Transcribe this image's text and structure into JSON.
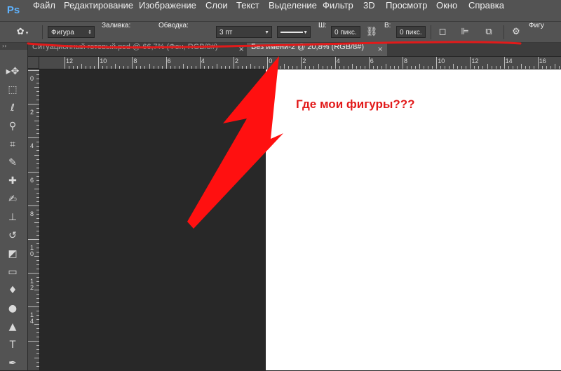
{
  "app": {
    "logo": "Ps"
  },
  "menu": {
    "items": [
      "Файл",
      "Редактирование",
      "Изображение",
      "Слои",
      "Текст",
      "Выделение",
      "Фильтр",
      "3D",
      "Просмотр",
      "Окно",
      "Справка"
    ]
  },
  "options": {
    "mode_value": "Фигура",
    "fill_label": "Заливка:",
    "fill_color": "#857c0b",
    "stroke_label": "Обводка:",
    "stroke_width_value": "3 пт",
    "width_label": "Ш:",
    "width_value": "0 пикс.",
    "height_label": "В:",
    "height_value": "0 пикс.",
    "shape_label": "Фигу"
  },
  "tabs": [
    {
      "label": "Ситуационный готовый.psd @ 66,7% (Фон, RGB/8#)",
      "close": "×",
      "active": false
    },
    {
      "label": "Без имени-2 @ 20,8% (RGB/8#)",
      "close": "×",
      "active": true
    }
  ],
  "rulers": {
    "horizontal": [
      "12",
      "10",
      "8",
      "6",
      "4",
      "2",
      "0",
      "2",
      "4",
      "6",
      "8",
      "10",
      "12",
      "14",
      "16"
    ],
    "vertical": [
      "0",
      "2",
      "4",
      "6",
      "8",
      "1 0",
      "1 2",
      "1 4"
    ]
  },
  "toolbox": {
    "header": "››",
    "tools": [
      {
        "name": "move-tool-icon",
        "glyph": "▸✥"
      },
      {
        "name": "marquee-tool-icon",
        "glyph": "⬚"
      },
      {
        "name": "lasso-tool-icon",
        "glyph": "ℓ"
      },
      {
        "name": "quick-selection-tool-icon",
        "glyph": "⚲"
      },
      {
        "name": "crop-tool-icon",
        "glyph": "⌗"
      },
      {
        "name": "eyedropper-tool-icon",
        "glyph": "✎"
      },
      {
        "name": "healing-brush-tool-icon",
        "glyph": "✚"
      },
      {
        "name": "brush-tool-icon",
        "glyph": "✍"
      },
      {
        "name": "clone-stamp-tool-icon",
        "glyph": "⊥"
      },
      {
        "name": "history-brush-tool-icon",
        "glyph": "↺"
      },
      {
        "name": "eraser-tool-icon",
        "glyph": "◩"
      },
      {
        "name": "gradient-tool-icon",
        "glyph": "▭"
      },
      {
        "name": "blur-tool-icon",
        "glyph": "♦"
      },
      {
        "name": "dodge-tool-icon",
        "glyph": "●"
      },
      {
        "name": "path-selection-tool-icon",
        "glyph": "▲"
      },
      {
        "name": "type-tool-icon",
        "glyph": "T"
      },
      {
        "name": "pen-tool-icon",
        "glyph": "✒"
      }
    ]
  },
  "annotation": {
    "text": "Где мои фигуры???",
    "color": "#e21a1a"
  }
}
